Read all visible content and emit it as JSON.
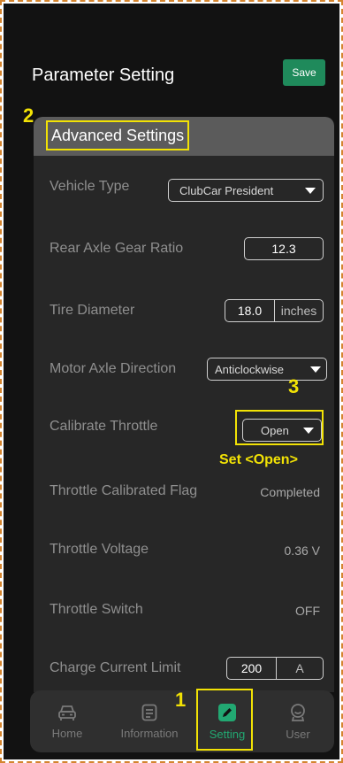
{
  "header": {
    "title": "Parameter Setting",
    "save_label": "Save"
  },
  "panel": {
    "title": "Advanced Settings"
  },
  "rows": {
    "vehicle_type": {
      "label": "Vehicle Type",
      "value": "ClubCar President"
    },
    "rear_axle_gear_ratio": {
      "label": "Rear Axle Gear Ratio",
      "value": "12.3"
    },
    "tire_diameter": {
      "label": "Tire Diameter",
      "value": "18.0",
      "unit": "inches"
    },
    "motor_axle_direction": {
      "label": "Motor Axle Direction",
      "value": "Anticlockwise"
    },
    "calibrate_throttle": {
      "label": "Calibrate Throttle",
      "value": "Open"
    },
    "throttle_calibrated_flag": {
      "label": "Throttle Calibrated Flag",
      "value": "Completed"
    },
    "throttle_voltage": {
      "label": "Throttle Voltage",
      "value": "0.36 V"
    },
    "throttle_switch": {
      "label": "Throttle Switch",
      "value": "OFF"
    },
    "charge_current_limit": {
      "label": "Charge Current Limit",
      "value": "200",
      "unit": "A"
    }
  },
  "annotations": {
    "step1": "1",
    "step2": "2",
    "step3": "3",
    "step3_text": "Set <Open>"
  },
  "nav": {
    "items": [
      {
        "label": "Home",
        "icon": "car-icon"
      },
      {
        "label": "Information",
        "icon": "document-icon"
      },
      {
        "label": "Setting",
        "icon": "edit-icon"
      },
      {
        "label": "User",
        "icon": "user-icon"
      }
    ],
    "active": "Setting"
  },
  "colors": {
    "accent": "#22a872",
    "save_button": "#1f8a5b",
    "annotation": "#f2e205",
    "frame_border": "#d4842e"
  }
}
